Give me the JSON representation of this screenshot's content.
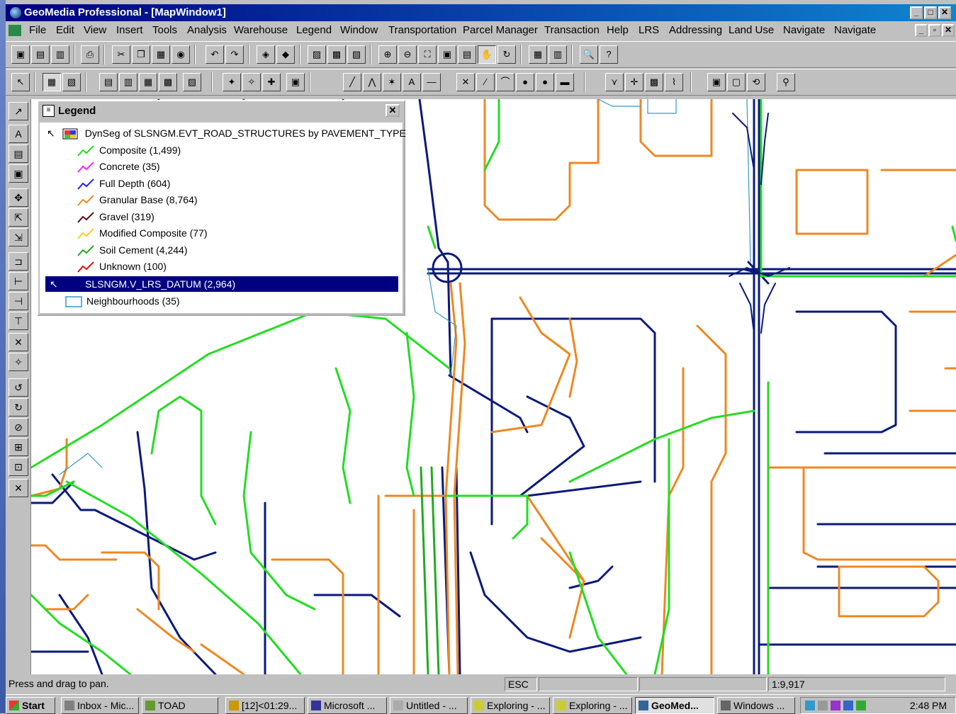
{
  "window": {
    "title": "GeoMedia Professional - [MapWindow1]",
    "min_glyph": "_",
    "max_glyph": "□",
    "close_glyph": "✕"
  },
  "menu": [
    "File",
    "Edit",
    "View",
    "Insert",
    "Tools",
    "Analysis",
    "Warehouse",
    "Legend",
    "Window",
    "Transportation",
    "Parcel Manager",
    "Transaction",
    "Help",
    "LRS",
    "Addressing",
    "Land Use",
    "Navigate",
    "Navigate"
  ],
  "legend": {
    "title": "Legend",
    "close_glyph": "✕",
    "group_title": "DynSeg of SLSNGM.EVT_ROAD_STRUCTURES by PAVEMENT_TYPE",
    "items": [
      {
        "label": "Composite  (1,499)",
        "color": "#22dd22"
      },
      {
        "label": "Concrete  (35)",
        "color": "#ff22ff"
      },
      {
        "label": "Full Depth  (604)",
        "color": "#2222ee"
      },
      {
        "label": "Granular Base  (8,764)",
        "color": "#ee8822"
      },
      {
        "label": "Gravel  (319)",
        "color": "#551111"
      },
      {
        "label": "Modified Composite  (77)",
        "color": "#ffcc22"
      },
      {
        "label": "Soil Cement  (4,244)",
        "color": "#22aa22"
      },
      {
        "label": "Unknown  (100)",
        "color": "#dd1111"
      }
    ],
    "datum": "SLSNGM.V_LRS_DATUM  (2,964)",
    "neighbourhoods": "Neighbourhoods  (35)"
  },
  "status": {
    "message": "Press and drag to pan.",
    "esc": "ESC",
    "scale": "1:9,917"
  },
  "taskbar": {
    "start": "Start",
    "tasks": [
      "Inbox - Mic...",
      "TOAD",
      "[12]<01:29...",
      "Microsoft ...",
      "Untitled - ...",
      "Exploring - ...",
      "Exploring - ...",
      "GeoMed...",
      "Windows ..."
    ],
    "clock": "2:48 PM"
  },
  "colors": {
    "datum": "#0a1a7a",
    "granular": "#ee8822",
    "composite": "#22dd22",
    "soil": "#22aa22",
    "neighbourhood": "#3399cc"
  }
}
